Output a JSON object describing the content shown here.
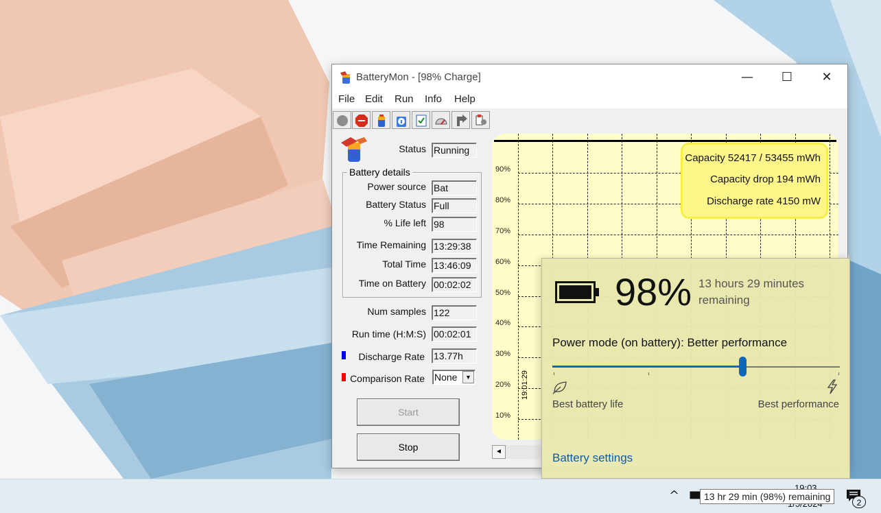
{
  "window": {
    "title": "BatteryMon - [98% Charge]",
    "min_glyph": "—",
    "max_glyph": "☐",
    "close_glyph": "✕"
  },
  "menu": [
    "File",
    "Edit",
    "Run",
    "Info",
    "Help"
  ],
  "toolbar_icons": [
    "record-icon",
    "stop-sign-icon",
    "battery-icon",
    "info-icon",
    "checklist-icon",
    "gauge-icon",
    "export-icon",
    "settings-icon"
  ],
  "status": {
    "label": "Status",
    "value": "Running"
  },
  "battery_details": {
    "legend": "Battery details",
    "rows": [
      {
        "label": "Power source",
        "value": "Bat"
      },
      {
        "label": "Battery Status",
        "value": "Full"
      },
      {
        "label": "% Life left",
        "value": "98"
      },
      {
        "label": "Time Remaining",
        "value": "13:29:38"
      },
      {
        "label": "Total Time",
        "value": "13:46:09"
      },
      {
        "label": "Time on Battery",
        "value": "00:02:02"
      }
    ]
  },
  "stats": {
    "num_samples": {
      "label": "Num samples",
      "value": "122"
    },
    "run_time": {
      "label": "Run time (H:M:S)",
      "value": "00:02:01"
    },
    "discharge": {
      "label": "Discharge Rate",
      "value": "13.77h",
      "color": "#0000ff"
    },
    "comparison": {
      "label": "Comparison Rate",
      "value": "None",
      "color": "#ff0000"
    }
  },
  "buttons": {
    "start": "Start",
    "stop": "Stop"
  },
  "graph": {
    "percent_labels": [
      "90%",
      "80%",
      "70%",
      "60%",
      "50%",
      "40%",
      "30%",
      "20%",
      "10%"
    ],
    "capacity": "Capacity 52417 / 53455 mWh",
    "capacity_drop": "Capacity drop 194 mWh",
    "discharge_rate": "Discharge rate 4150 mW",
    "time_label": "19:01:29",
    "scroll_left_glyph": "◄"
  },
  "flyout": {
    "percent": "98%",
    "remaining": "13 hours 29 minutes remaining",
    "power_mode": "Power mode (on battery): Better performance",
    "slider_value": 0.66,
    "min_label": "Best battery life",
    "max_label": "Best performance",
    "settings_link": "Battery settings"
  },
  "taskbar": {
    "tooltip": "13 hr 29 min (98%) remaining",
    "time": "19:03",
    "date": "1/5/2024",
    "notifications": "2",
    "chevron_glyph": "^"
  }
}
